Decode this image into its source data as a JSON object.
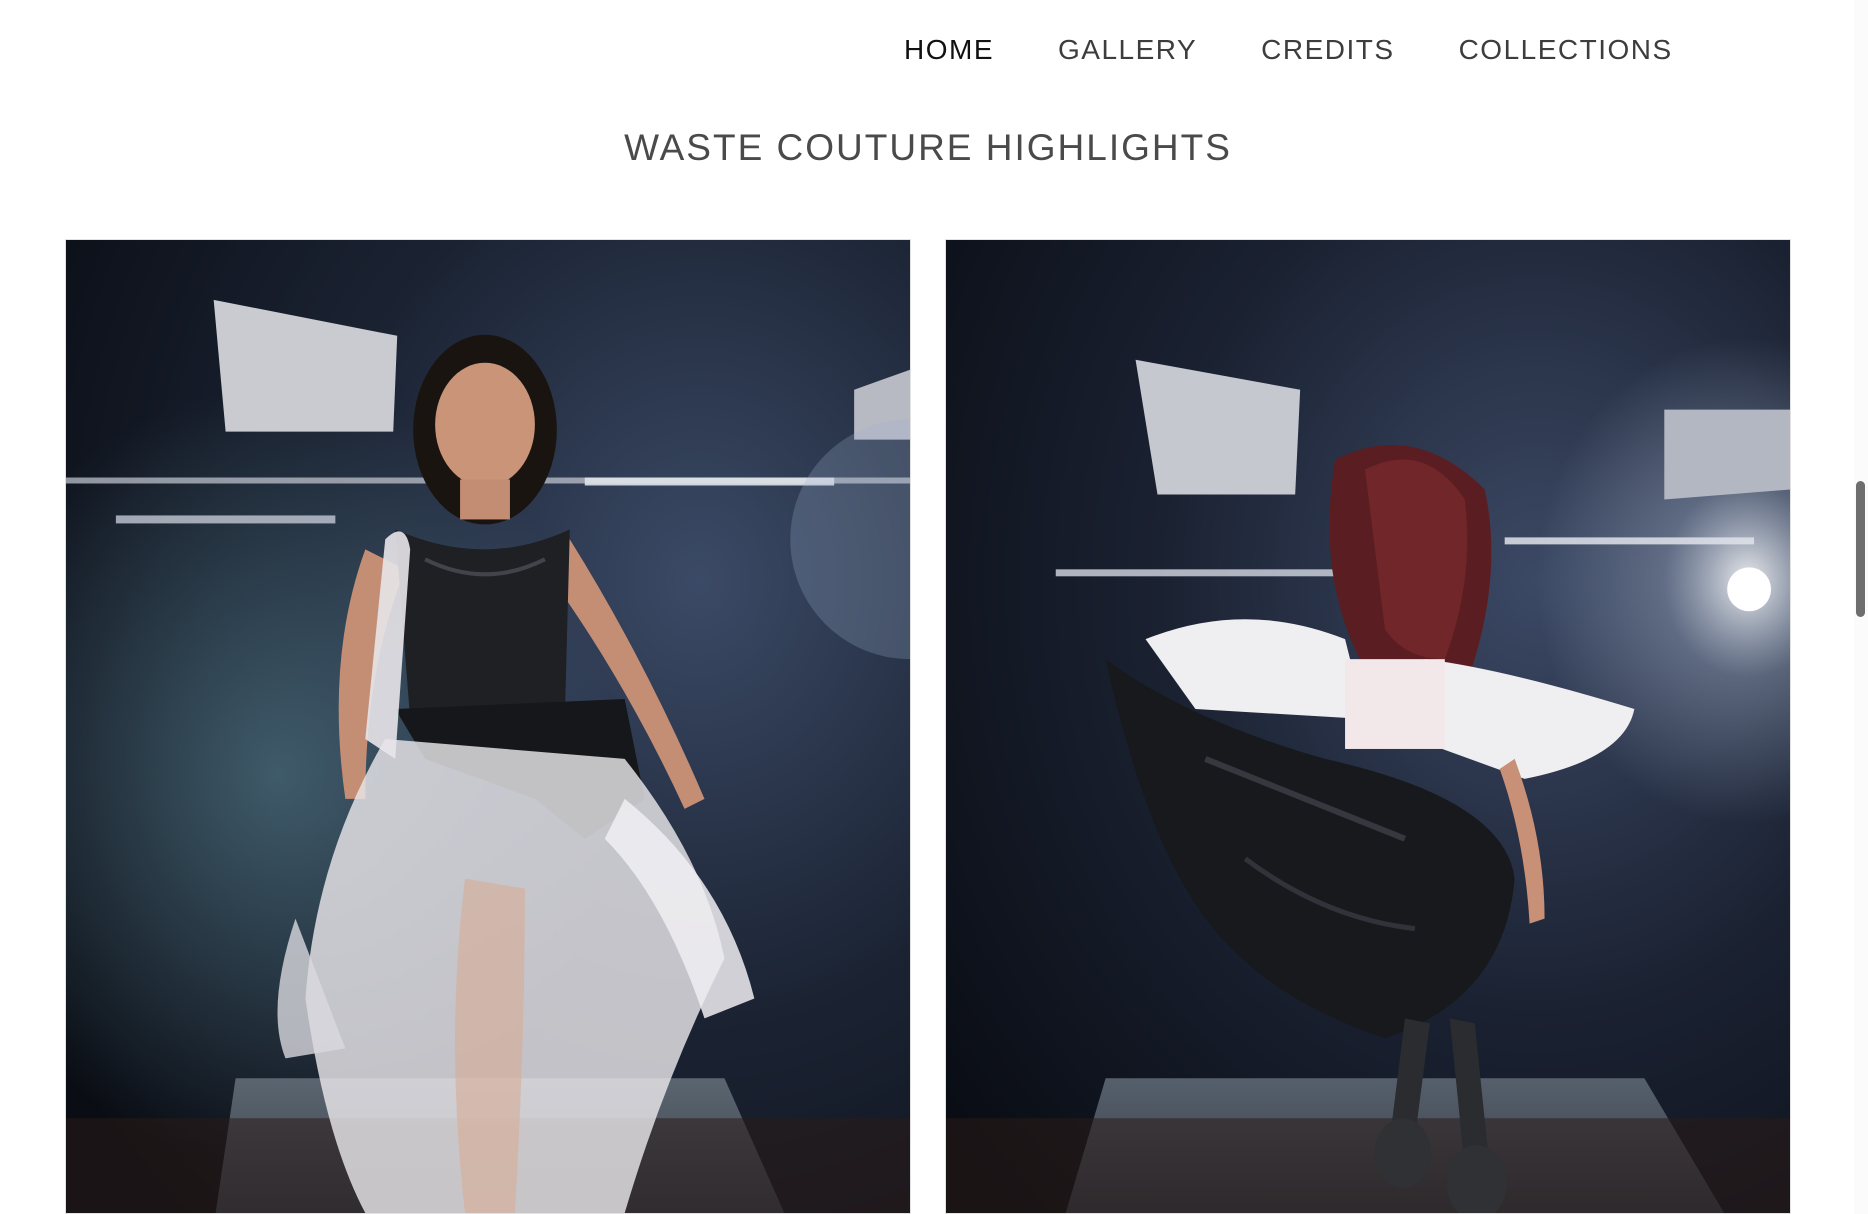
{
  "nav": {
    "items": [
      {
        "label": "HOME",
        "active": true
      },
      {
        "label": "GALLERY",
        "active": false
      },
      {
        "label": "CREDITS",
        "active": false
      },
      {
        "label": "COLLECTIONS",
        "active": false
      }
    ]
  },
  "section": {
    "title": "WASTE COUTURE HIGHLIGHTS"
  },
  "gallery": {
    "photos": [
      {
        "subject": "model walking runway in black and clear plastic bag dress, front view"
      },
      {
        "subject": "model twirling on runway in white and black plastic bag outfit, back view"
      }
    ]
  },
  "colors": {
    "text_dark": "#111111",
    "text_nav": "#3d3d3d",
    "text_heading": "#4a4a4a",
    "stage_dark": "#0f141d"
  }
}
